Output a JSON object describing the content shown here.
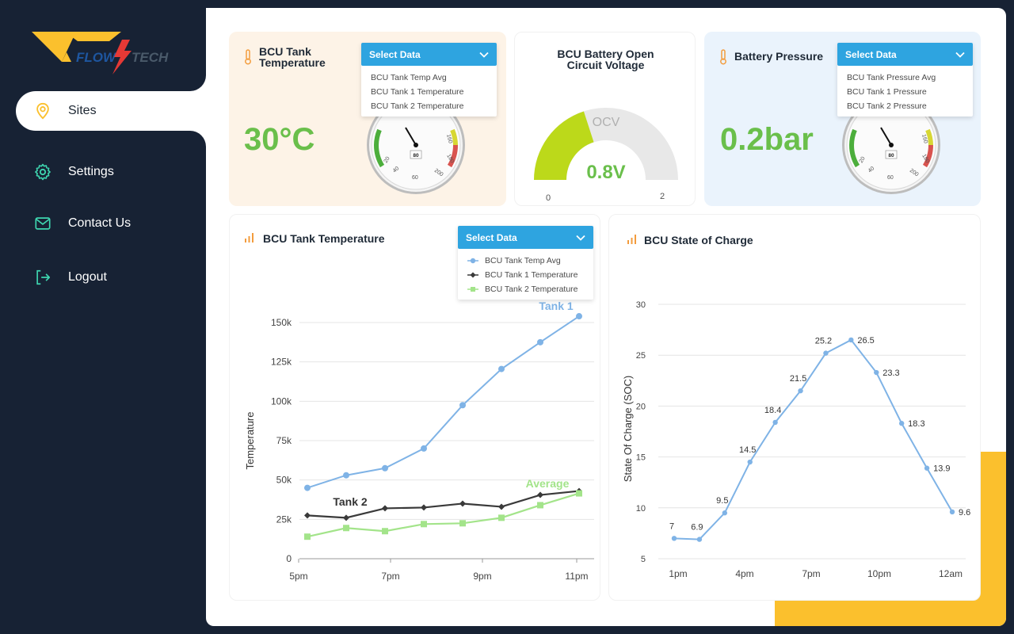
{
  "brand": {
    "text_left": "FLOW",
    "text_right": "TECH",
    "accent": "#fbc02d",
    "secondary": "#1e56a0",
    "bolt": "#e53935"
  },
  "nav": {
    "items": [
      {
        "label": "Sites",
        "icon": "location-pin-icon",
        "active": true
      },
      {
        "label": "Settings",
        "icon": "gear-icon",
        "active": false
      },
      {
        "label": "Contact Us",
        "icon": "mail-icon",
        "active": false
      },
      {
        "label": "Logout",
        "icon": "logout-icon",
        "active": false
      }
    ]
  },
  "cards": {
    "tank_temp": {
      "title": "BCU Tank Temperature",
      "title_line1": "BCU Tank",
      "title_line2": "Temperature",
      "value": "30°C",
      "gauge_center": "80",
      "gauge_ticks": [
        "20",
        "40",
        "60",
        "160",
        "180",
        "200"
      ],
      "dropdown": {
        "label": "Select Data",
        "options": [
          "BCU Tank Temp Avg",
          "BCU Tank 1 Temperature",
          "BCU Tank 2 Temperature"
        ]
      }
    },
    "ocv": {
      "title_line1": "BCU Battery Open",
      "title_line2": "Circuit Voltage",
      "gauge_label": "OCV",
      "value": "0.8V",
      "min": "0",
      "max": "2",
      "fraction": 0.4
    },
    "pressure": {
      "title": "Battery Pressure",
      "value": "0.2bar",
      "gauge_center": "80",
      "gauge_ticks": [
        "20",
        "40",
        "60",
        "160",
        "180",
        "200"
      ],
      "dropdown": {
        "label": "Select Data",
        "options": [
          "BCU Tank Pressure Avg",
          "BCU Tank 1 Pressure",
          "BCU Tank 2 Pressure"
        ]
      }
    }
  },
  "temp_chart_card": {
    "title": "BCU Tank Temperature",
    "dropdown": {
      "label": "Select Data",
      "options": [
        "BCU Tank Temp Avg",
        "BCU Tank 1 Temperature",
        "BCU Tank 2 Temperature"
      ]
    }
  },
  "soc_chart_card": {
    "title": "BCU State of Charge"
  },
  "colors": {
    "primary": "#2ea4e0",
    "green": "#6abf4b",
    "sidebar": "#172234",
    "warm_card": "#fdf3e7",
    "cool_card": "#eaf3fc"
  },
  "chart_data": [
    {
      "type": "line",
      "ylabel": "Temperature",
      "xlabel": "",
      "x_ticks": [
        "5pm",
        "7pm",
        "9pm",
        "11pm"
      ],
      "y_ticks": [
        "0",
        "25k",
        "50k",
        "75k",
        "100k",
        "125k",
        "150k"
      ],
      "ylim": [
        0,
        150000
      ],
      "series": [
        {
          "name": "Tank 1",
          "color": "#7fb3e6",
          "marker": "circle",
          "values": [
            45000,
            53000,
            57500,
            70000,
            97500,
            120500,
            137500,
            154000
          ]
        },
        {
          "name": "Tank 2",
          "color": "#3a3a3a",
          "marker": "diamond",
          "values": [
            27500,
            26000,
            32000,
            32500,
            35000,
            33000,
            40500,
            43000
          ]
        },
        {
          "name": "Average",
          "color": "#a3e48a",
          "marker": "square",
          "values": [
            14000,
            19500,
            17500,
            22000,
            22500,
            26000,
            34000,
            41500
          ]
        }
      ],
      "annotations": [
        "Tank 1",
        "Tank 2",
        "Average"
      ],
      "grid": true
    },
    {
      "type": "line",
      "ylabel": "State Of Charge (SOC)",
      "xlabel": "",
      "x_ticks": [
        "1pm",
        "4pm",
        "7pm",
        "10pm",
        "12am"
      ],
      "y_ticks": [
        "5",
        "10",
        "15",
        "20",
        "25",
        "30"
      ],
      "ylim": [
        5,
        30
      ],
      "series": [
        {
          "color": "#7fb3e6",
          "values": [
            7,
            6.9,
            9.5,
            14.5,
            18.4,
            21.5,
            25.2,
            26.5,
            23.3,
            18.3,
            13.9,
            9.6
          ]
        }
      ],
      "grid": true
    }
  ]
}
